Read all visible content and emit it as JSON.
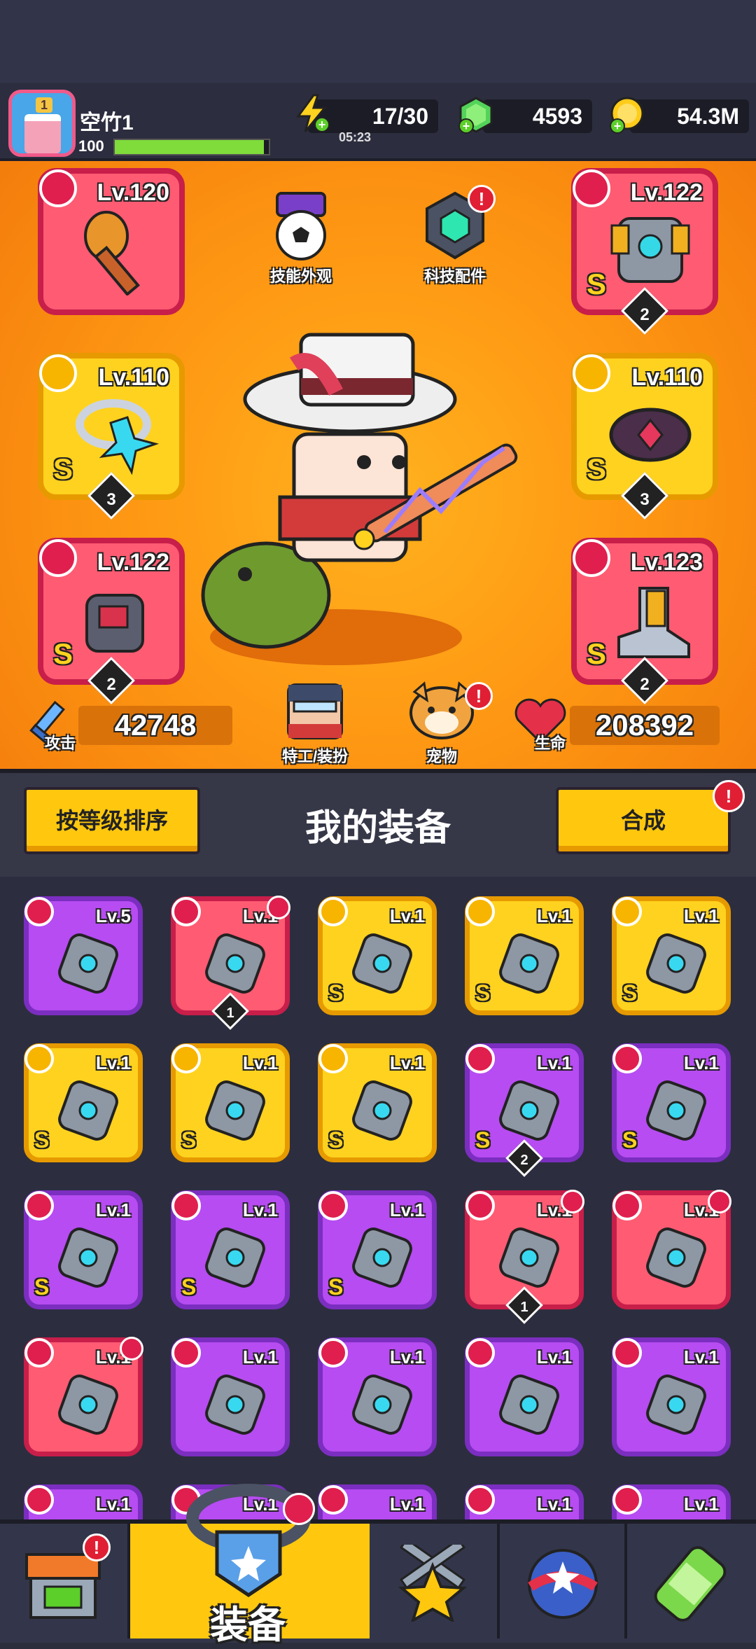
{
  "player": {
    "name": "空竹1",
    "level": "100",
    "xp_progress": 0.97
  },
  "resources": {
    "energy": {
      "value": "17/30",
      "timer": "05:23"
    },
    "gems": {
      "value": "4593"
    },
    "coins": {
      "value": "54.3M"
    }
  },
  "hero": {
    "features": {
      "skill_skin": "技能外观",
      "tech_parts": "科技配件",
      "agent_outfit": "特工/装扮",
      "pet": "宠物"
    },
    "stats": {
      "attack_label": "攻击",
      "attack_value": "42748",
      "hp_label": "生命",
      "hp_value": "208392"
    },
    "slots": [
      {
        "lv": "Lv.120",
        "grade": "",
        "stars": "",
        "rarity": "red",
        "icon": "weapon-slot-icon"
      },
      {
        "lv": "Lv.122",
        "grade": "S",
        "stars": "2",
        "rarity": "red",
        "icon": "armor-slot-icon"
      },
      {
        "lv": "Lv.110",
        "grade": "S",
        "stars": "3",
        "rarity": "gold",
        "icon": "necklace-slot-icon"
      },
      {
        "lv": "Lv.110",
        "grade": "S",
        "stars": "3",
        "rarity": "gold",
        "icon": "belt-slot-icon"
      },
      {
        "lv": "Lv.122",
        "grade": "S",
        "stars": "2",
        "rarity": "red",
        "icon": "glove-slot-icon"
      },
      {
        "lv": "Lv.123",
        "grade": "S",
        "stars": "2",
        "rarity": "red",
        "icon": "boot-slot-icon"
      }
    ]
  },
  "equipment": {
    "sort_button": "按等级排序",
    "title": "我的装备",
    "merge_button": "合成",
    "alert": "!",
    "items": [
      {
        "lv": "Lv.5",
        "grade": "",
        "stars": "",
        "rarity": "purple"
      },
      {
        "lv": "Lv.1",
        "grade": "",
        "stars": "1",
        "rarity": "red"
      },
      {
        "lv": "Lv.1",
        "grade": "S",
        "stars": "",
        "rarity": "gold"
      },
      {
        "lv": "Lv.1",
        "grade": "S",
        "stars": "",
        "rarity": "gold"
      },
      {
        "lv": "Lv.1",
        "grade": "S",
        "stars": "",
        "rarity": "gold"
      },
      {
        "lv": "Lv.1",
        "grade": "S",
        "stars": "",
        "rarity": "gold"
      },
      {
        "lv": "Lv.1",
        "grade": "S",
        "stars": "",
        "rarity": "gold"
      },
      {
        "lv": "Lv.1",
        "grade": "S",
        "stars": "",
        "rarity": "gold"
      },
      {
        "lv": "Lv.1",
        "grade": "S",
        "stars": "2",
        "rarity": "purple"
      },
      {
        "lv": "Lv.1",
        "grade": "S",
        "stars": "",
        "rarity": "purple"
      },
      {
        "lv": "Lv.1",
        "grade": "S",
        "stars": "",
        "rarity": "purple"
      },
      {
        "lv": "Lv.1",
        "grade": "S",
        "stars": "",
        "rarity": "purple"
      },
      {
        "lv": "Lv.1",
        "grade": "S",
        "stars": "",
        "rarity": "purple"
      },
      {
        "lv": "Lv.1",
        "grade": "",
        "stars": "1",
        "rarity": "red"
      },
      {
        "lv": "Lv.1",
        "grade": "",
        "stars": "",
        "rarity": "red"
      },
      {
        "lv": "Lv.1",
        "grade": "",
        "stars": "",
        "rarity": "red"
      },
      {
        "lv": "Lv.1",
        "grade": "",
        "stars": "",
        "rarity": "purple"
      },
      {
        "lv": "Lv.1",
        "grade": "",
        "stars": "",
        "rarity": "purple"
      },
      {
        "lv": "Lv.1",
        "grade": "",
        "stars": "",
        "rarity": "purple"
      },
      {
        "lv": "Lv.1",
        "grade": "",
        "stars": "",
        "rarity": "purple"
      },
      {
        "lv": "Lv.1",
        "grade": "",
        "stars": "",
        "rarity": "purple"
      },
      {
        "lv": "Lv.1",
        "grade": "",
        "stars": "",
        "rarity": "purple"
      },
      {
        "lv": "Lv.1",
        "grade": "",
        "stars": "",
        "rarity": "purple"
      },
      {
        "lv": "Lv.1",
        "grade": "",
        "stars": "",
        "rarity": "purple"
      },
      {
        "lv": "Lv.1",
        "grade": "",
        "stars": "",
        "rarity": "purple"
      }
    ]
  },
  "nav": {
    "active_label": "装备",
    "alert": "!"
  }
}
